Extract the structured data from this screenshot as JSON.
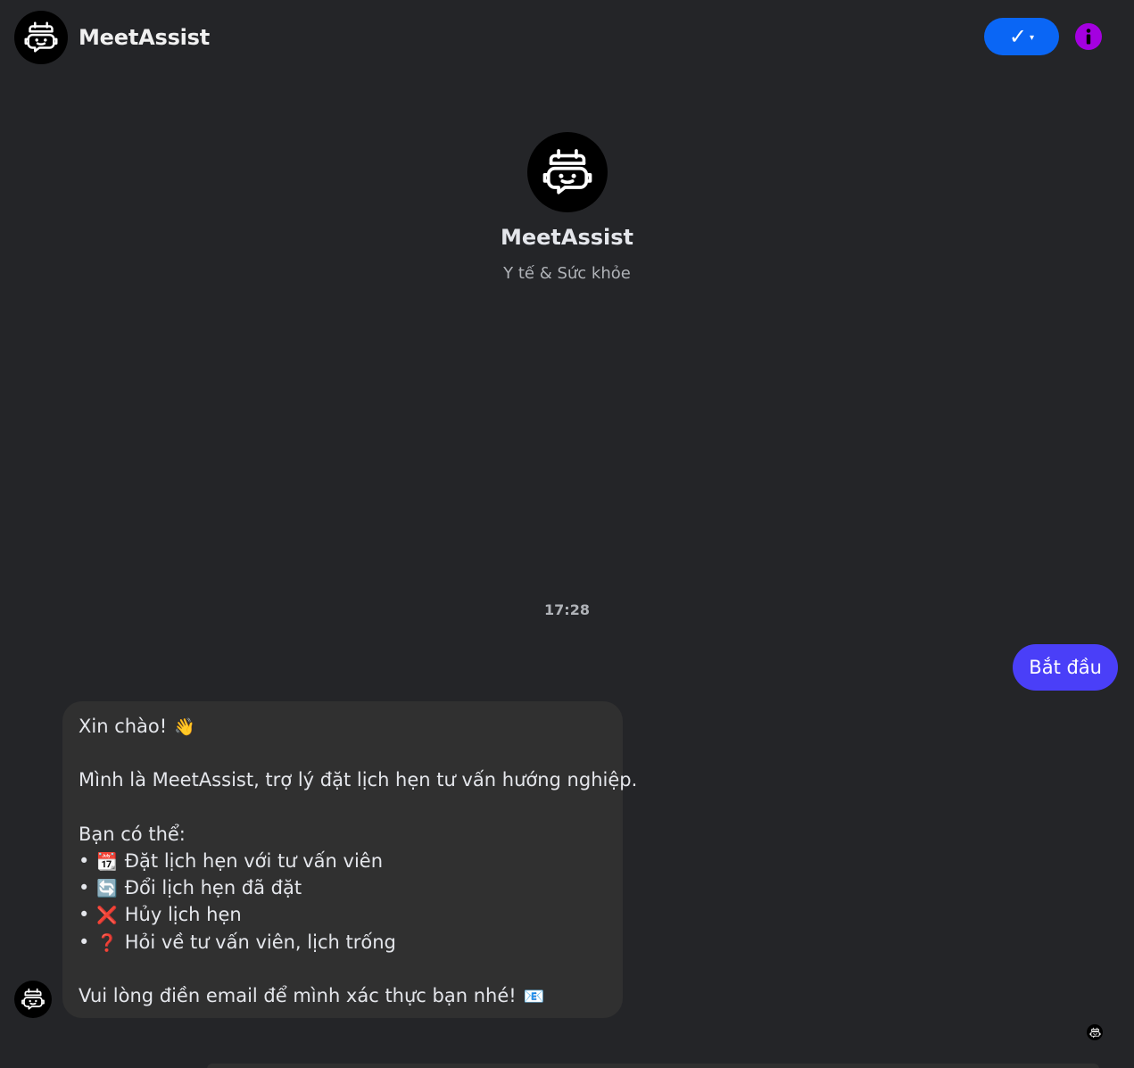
{
  "header": {
    "title": "MeetAssist",
    "verify_check": "✓",
    "verify_caret": "▾",
    "info_label": "i"
  },
  "profile": {
    "name": "MeetAssist",
    "category": "Y tế & Sức khỏe"
  },
  "conversation": {
    "timestamp": "17:28",
    "user_message": "Bắt đầu",
    "bot_message": {
      "greeting": "Xin chào!",
      "greeting_emoji": "👋",
      "intro": "Mình là MeetAssist, trợ lý đặt lịch hẹn tư vấn hướng nghiệp.",
      "options_heading": "Bạn có thể:",
      "bullet": "•",
      "options": [
        {
          "emoji": "📆",
          "text": "Đặt lịch hẹn với tư vấn viên"
        },
        {
          "emoji": "🔄",
          "text": "Đổi lịch hẹn đã đặt"
        },
        {
          "emoji": "❌",
          "text": "Hủy lịch hẹn"
        },
        {
          "emoji": "❓",
          "text": "Hỏi về tư vấn viên, lịch trống"
        }
      ],
      "closing": "Vui lòng điền email để mình xác thực bạn nhé!",
      "closing_emoji": "📧"
    }
  },
  "colors": {
    "background": "#242528",
    "bot_bubble": "#303030",
    "user_bubble": "#4a3ff8",
    "verify_button": "#0a66f5",
    "info_icon": "#a400e0"
  },
  "icons": {
    "avatar": "robot-calendar-icon",
    "info": "info-icon",
    "verify": "check-icon"
  }
}
